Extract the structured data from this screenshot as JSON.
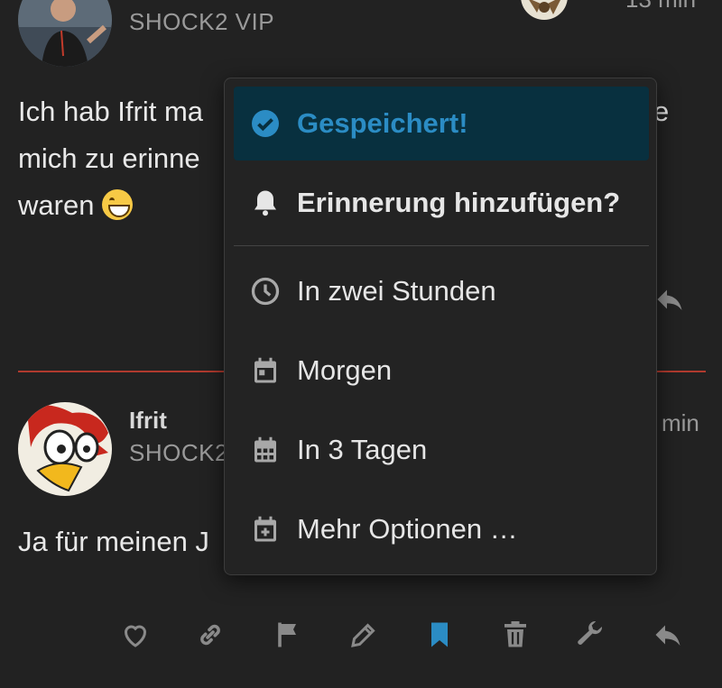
{
  "post1": {
    "usertitle": "SHOCK2 VIP",
    "timestamp": "13 min",
    "text_line1": "Ich hab Ifrit ma",
    "text_line1_tail": "e",
    "text_line2": "mich zu erinne",
    "text_line3": "waren"
  },
  "post2": {
    "username": "Ifrit",
    "usertitle": "SHOCK2",
    "timestamp": "min",
    "text_line1": "Ja für meinen J"
  },
  "menu": {
    "items": [
      {
        "label": "Gespeichert!",
        "icon": "check-circle-icon"
      },
      {
        "label": "Erinnerung hinzufügen?",
        "icon": "bell-icon"
      },
      {
        "label": "In zwei Stunden",
        "icon": "clock-icon"
      },
      {
        "label": "Morgen",
        "icon": "calendar-day-icon"
      },
      {
        "label": "In 3 Tagen",
        "icon": "calendar-week-icon"
      },
      {
        "label": "Mehr Optionen …",
        "icon": "calendar-plus-icon"
      }
    ]
  },
  "actions": [
    "heart-icon",
    "link-icon",
    "flag-icon",
    "pencil-icon",
    "bookmark-icon",
    "trash-icon",
    "wrench-icon",
    "reply-icon"
  ],
  "colors": {
    "background": "#222222",
    "accent": "#2b8cc4",
    "active_item_bg": "#08303f",
    "divider": "#b03a2e",
    "icon_muted": "#8a8a8a"
  }
}
